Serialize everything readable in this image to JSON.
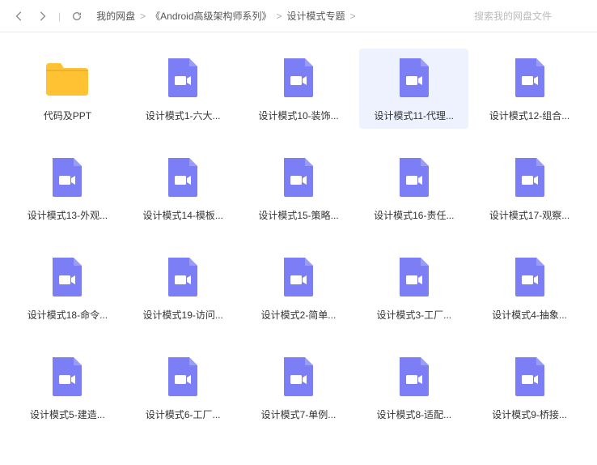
{
  "nav": {
    "back": "后退",
    "forward": "前进",
    "refresh": "刷新"
  },
  "breadcrumb": {
    "items": [
      "我的网盘",
      "《Android高级架构师系列》",
      "设计模式专题"
    ],
    "separator": ">"
  },
  "search": {
    "placeholder": "搜索我的网盘文件"
  },
  "files": [
    {
      "type": "folder",
      "name": "代码及PPT",
      "selected": false
    },
    {
      "type": "video",
      "name": "设计模式1-六大...",
      "selected": false
    },
    {
      "type": "video",
      "name": "设计模式10-装饰...",
      "selected": false
    },
    {
      "type": "video",
      "name": "设计模式11-代理...",
      "selected": true
    },
    {
      "type": "video",
      "name": "设计模式12-组合...",
      "selected": false
    },
    {
      "type": "video",
      "name": "设计模式13-外观...",
      "selected": false
    },
    {
      "type": "video",
      "name": "设计模式14-模板...",
      "selected": false
    },
    {
      "type": "video",
      "name": "设计模式15-策略...",
      "selected": false
    },
    {
      "type": "video",
      "name": "设计模式16-责任...",
      "selected": false
    },
    {
      "type": "video",
      "name": "设计模式17-观察...",
      "selected": false
    },
    {
      "type": "video",
      "name": "设计模式18-命令...",
      "selected": false
    },
    {
      "type": "video",
      "name": "设计模式19-访问...",
      "selected": false
    },
    {
      "type": "video",
      "name": "设计模式2-简单...",
      "selected": false
    },
    {
      "type": "video",
      "name": "设计模式3-工厂...",
      "selected": false
    },
    {
      "type": "video",
      "name": "设计模式4-抽象...",
      "selected": false
    },
    {
      "type": "video",
      "name": "设计模式5-建造...",
      "selected": false
    },
    {
      "type": "video",
      "name": "设计模式6-工厂...",
      "selected": false
    },
    {
      "type": "video",
      "name": "设计模式7-单例...",
      "selected": false
    },
    {
      "type": "video",
      "name": "设计模式8-适配...",
      "selected": false
    },
    {
      "type": "video",
      "name": "设计模式9-桥接...",
      "selected": false
    }
  ],
  "colors": {
    "folder": "#ffc233",
    "video": "#7b7ef4"
  }
}
